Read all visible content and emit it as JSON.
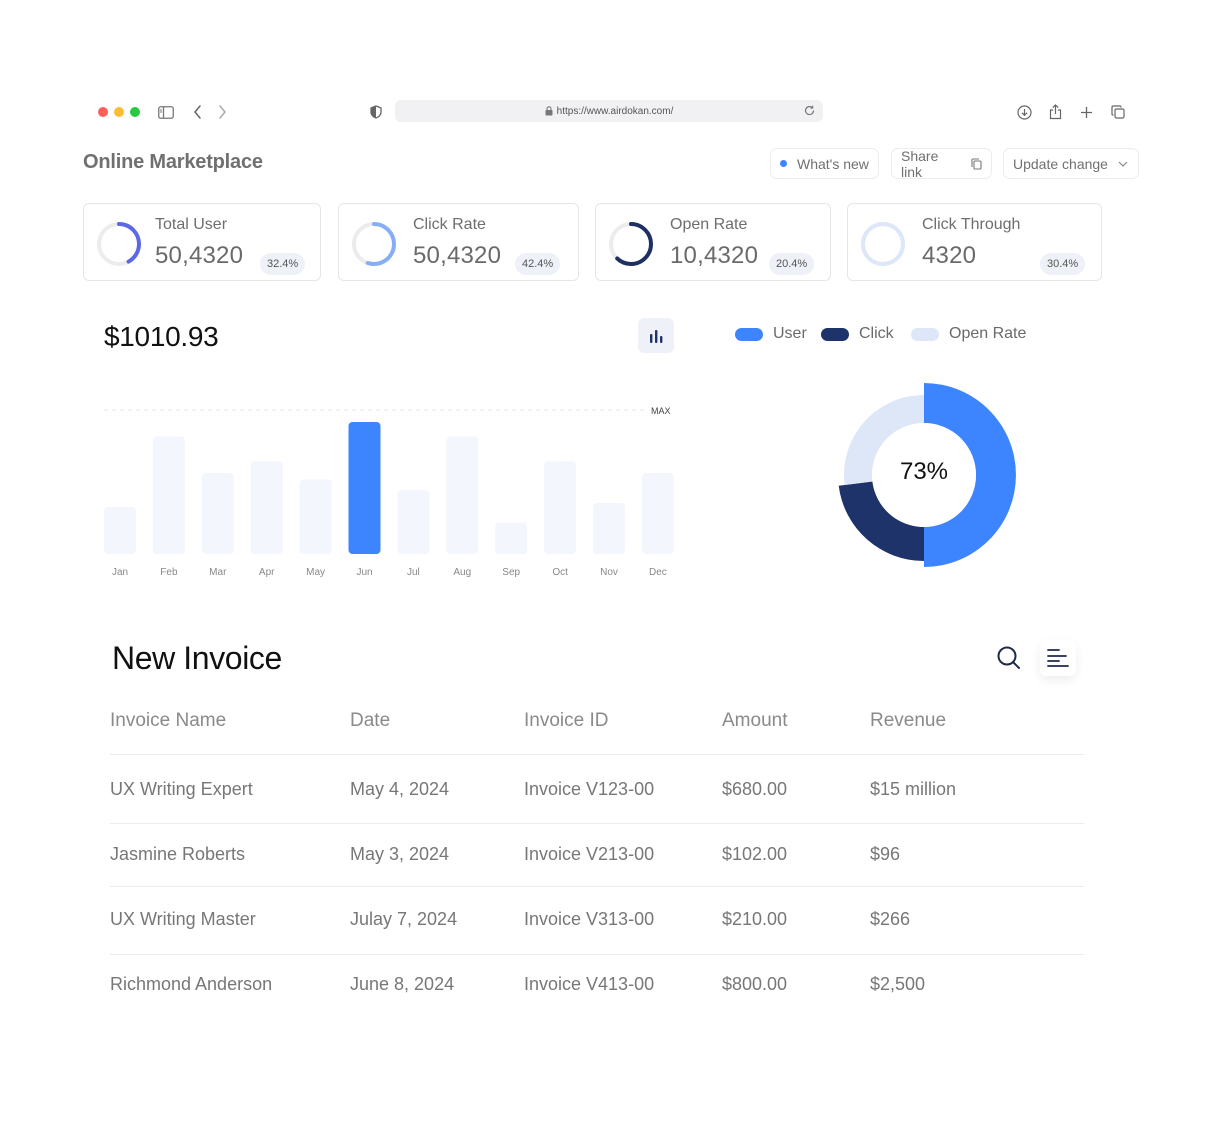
{
  "browser": {
    "url": "https://www.airdokan.com/",
    "traffic_lights": [
      "#ff5f57",
      "#febc2e",
      "#28c840"
    ]
  },
  "header": {
    "title": "Online Marketplace",
    "whats_new": "What's new",
    "share_link": "Share link",
    "update_change": "Update change"
  },
  "stats": [
    {
      "label": "Total User",
      "value": "50,4320",
      "change": "32.4%",
      "ring_color": "#5b67e6",
      "ring_fraction": 0.42
    },
    {
      "label": "Click Rate",
      "value": "50,4320",
      "change": "42.4%",
      "ring_color": "#86aef7",
      "ring_fraction": 0.55
    },
    {
      "label": "Open Rate",
      "value": "10,4320",
      "change": "20.4%",
      "ring_color": "#1e2f63",
      "ring_fraction": 0.62
    },
    {
      "label": "Click Through",
      "value": "4320",
      "change": "30.4%",
      "ring_color": "#dde7f8",
      "ring_fraction": 1.0
    }
  ],
  "revenue": {
    "total": "$1010.93",
    "max_label": "MAX"
  },
  "chart_data": [
    {
      "type": "bar",
      "categories": [
        "Jan",
        "Feb",
        "Mar",
        "Apr",
        "May",
        "Jun",
        "Jul",
        "Aug",
        "Sep",
        "Oct",
        "Nov",
        "Dec"
      ],
      "values": [
        36,
        90,
        62,
        71,
        57,
        101,
        49,
        90,
        24,
        71,
        39,
        62
      ],
      "highlight": "Jun",
      "colors": {
        "bar": "#f3f6fc",
        "highlight": "#3d85ff"
      }
    },
    {
      "type": "pie",
      "center_label": "73%",
      "series": [
        {
          "name": "User",
          "value": 50,
          "color": "#3d85ff"
        },
        {
          "name": "Click",
          "value": 23,
          "color": "#1e3369"
        },
        {
          "name": "Open Rate",
          "value": 27,
          "color": "#dde7f8"
        }
      ]
    }
  ],
  "invoice": {
    "title": "New Invoice",
    "columns": [
      "Invoice Name",
      "Date",
      "Invoice ID",
      "Amount",
      "Revenue"
    ],
    "rows": [
      [
        "UX Writing Expert",
        "May 4, 2024",
        "Invoice V123-00",
        "$680.00",
        "$15 million"
      ],
      [
        "Jasmine Roberts",
        "May 3, 2024",
        "Invoice V213-00",
        "$102.00",
        "$96"
      ],
      [
        "UX Writing Master",
        "Julay 7, 2024",
        "Invoice V313-00",
        "$210.00",
        "$266"
      ],
      [
        "Richmond Anderson",
        "June 8, 2024",
        "Invoice V413-00",
        "$800.00",
        "$2,500"
      ]
    ]
  }
}
